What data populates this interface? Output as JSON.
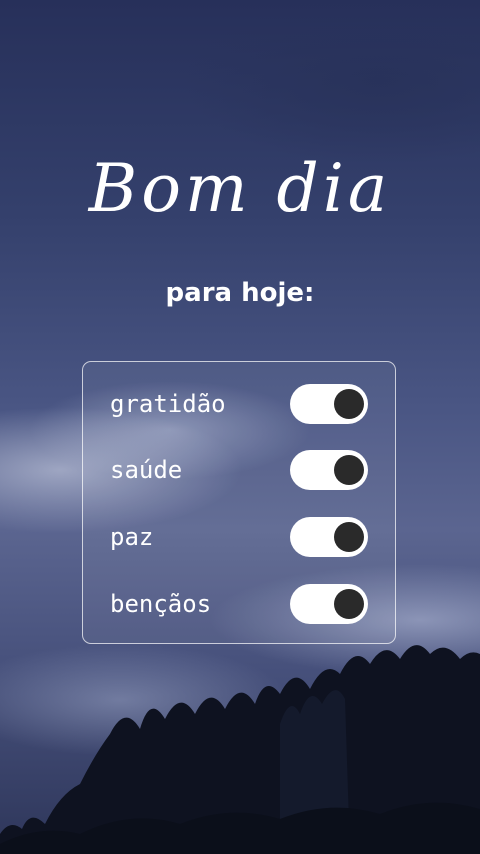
{
  "title": "Bom dia",
  "subtitle": "para hoje:",
  "items": [
    {
      "label": "gratidão",
      "on": true
    },
    {
      "label": "saúde",
      "on": true
    },
    {
      "label": "paz",
      "on": true
    },
    {
      "label": "bençãos",
      "on": true
    }
  ],
  "colors": {
    "text": "#ffffff",
    "toggle_track": "#ffffff",
    "toggle_knob": "#2a2a2a"
  }
}
